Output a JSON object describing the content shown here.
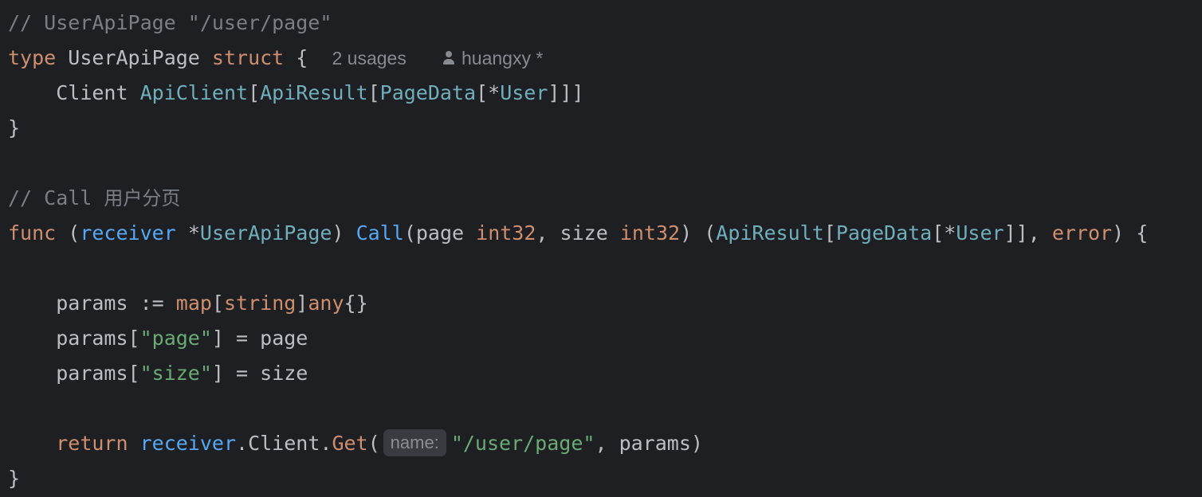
{
  "code": {
    "comment_struct": "// UserApiPage \"/user/page\"",
    "kw_type": "type",
    "struct_name": "UserApiPage",
    "kw_struct": "struct",
    "brace_open": "{",
    "usages": "2 usages",
    "author": "huangxy *",
    "field_name": "Client",
    "field_type_apiclient": "ApiClient",
    "bracket_open": "[",
    "type_apiresult": "ApiResult",
    "type_pagedata": "PageData",
    "star": "*",
    "type_user": "User",
    "brackets_close_3": "]]]",
    "brace_close": "}",
    "comment_call_prefix": "// Call ",
    "comment_call_cjk": "用户分页",
    "kw_func": "func",
    "paren_open": "(",
    "receiver": "receiver",
    "receiver_type": "UserApiPage",
    "paren_close": ")",
    "method_call": "Call",
    "param_page": "page",
    "type_int32": "int32",
    "comma": ",",
    "param_size": "size",
    "brackets_close_2": "]]",
    "type_error": "error",
    "params_var": "params",
    "assign_op": ":=",
    "kw_map": "map",
    "type_string": "string",
    "kw_any": "any",
    "empty_braces": "{}",
    "str_page": "\"page\"",
    "str_size": "\"size\"",
    "bracket_close": "]",
    "eq": "=",
    "kw_return": "return",
    "dot": ".",
    "field_client": "Client",
    "method_get": "Get",
    "hint_name": "name:",
    "str_user_page": "\"/user/page\""
  },
  "colors": {
    "background": "#1e1f22",
    "keyword": "#cf8e6d",
    "type": "#6fafbd",
    "function": "#56a8f5",
    "string": "#6aab73",
    "comment": "#7a7e85",
    "text": "#bcbec4"
  },
  "icons": {
    "author": "user-icon"
  }
}
